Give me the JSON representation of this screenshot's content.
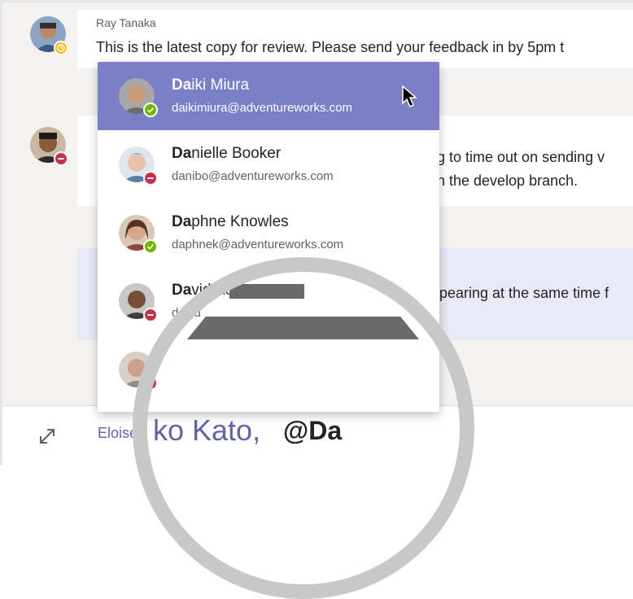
{
  "messages": [
    {
      "sender": "Ray Tanaka",
      "text": "This is the latest copy for review. Please send your feedback in by 5pm t",
      "status": "away"
    },
    {
      "text_line1": "g to time out on sending v",
      "text_line2": "n the develop branch.",
      "status": "busy"
    },
    {
      "text": "pearing at the same time f"
    }
  ],
  "mention_dropdown": {
    "items": [
      {
        "match": "Da",
        "rest": "iki Miura",
        "email": "daikimiura@adventureworks.com",
        "status": "available",
        "selected": true
      },
      {
        "match": "Da",
        "rest": "nielle Booker",
        "email": "danibo@adventureworks.com",
        "status": "busy"
      },
      {
        "match": "Da",
        "rest": "phne Knowles",
        "email": "daphnek@adventureworks.com",
        "status": "available"
      },
      {
        "match": "Da",
        "rest": "vid Ack",
        "email": "david",
        "status": "busy"
      },
      {
        "match": "",
        "rest": "",
        "email": "",
        "status": "busy"
      }
    ]
  },
  "compose": {
    "prefix": "Eloise I",
    "mention_text": "ko Kato,",
    "query": "@Da"
  },
  "colors": {
    "brand": "#6264a7",
    "selected_row": "#7b7fc6",
    "away": "#fdb913",
    "busy": "#c4314b",
    "available": "#6bb700"
  }
}
